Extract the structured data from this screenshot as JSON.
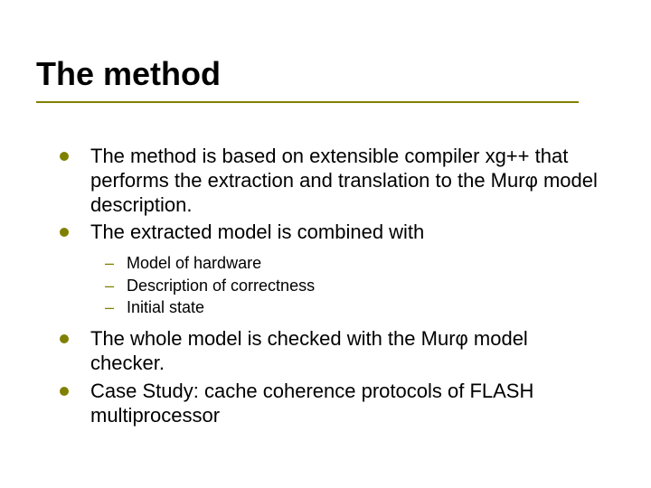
{
  "slide": {
    "title": "The method",
    "bullets_top": [
      "The method is based on extensible compiler xg++ that performs the extraction and translation to the Murφ model description.",
      "The extracted model is combined with"
    ],
    "sub_bullets": [
      "Model of hardware",
      "Description of correctness",
      "Initial state"
    ],
    "bullets_bottom": [
      "The whole model is checked with the Murφ model checker.",
      "Case Study: cache coherence protocols of FLASH multiprocessor"
    ]
  }
}
